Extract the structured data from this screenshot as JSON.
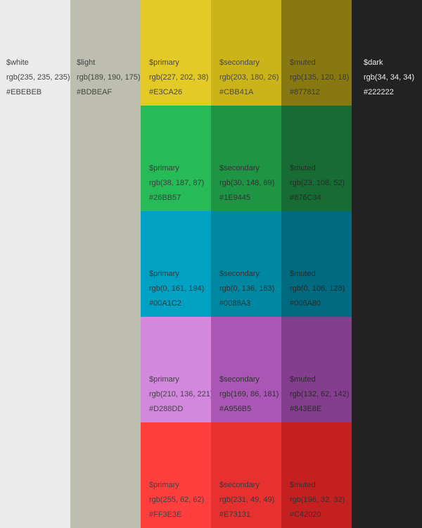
{
  "neutrals": {
    "white": {
      "name": "$white",
      "rgb": "rgb(235, 235, 235)",
      "hex": "#EBEBEB",
      "color": "#EBEBEB",
      "text_color": "#444444"
    },
    "light": {
      "name": "$light",
      "rgb": "rgb(189, 190, 175)",
      "hex": "#BDBEAF",
      "color": "#BDBEAF",
      "text_color": "#444444"
    },
    "dark": {
      "name": "$dark",
      "rgb": "rgb(34, 34, 34)",
      "hex": "#222222",
      "color": "#222222",
      "text_color": "#EEEEEE"
    }
  },
  "rows": [
    {
      "cells": [
        {
          "name": "$primary",
          "rgb": "rgb(227, 202, 38)",
          "hex": "#E3CA26",
          "color": "#E3CA26",
          "text_color": "#4A4A4A"
        },
        {
          "name": "$secondary",
          "rgb": "rgb(203, 180, 26)",
          "hex": "#CBB41A",
          "color": "#CBB41A",
          "text_color": "#4A4A4A"
        },
        {
          "name": "$muted",
          "rgb": "rgb(135, 120, 18)",
          "hex": "#877812",
          "color": "#877812",
          "text_color": "#3A3A3A"
        }
      ]
    },
    {
      "cells": [
        {
          "name": "$primary",
          "rgb": "rgb(38, 187, 87)",
          "hex": "#26BB57",
          "color": "#26BB57",
          "text_color": "#3E3E3E"
        },
        {
          "name": "$secondary",
          "rgb": "rgb(30, 148, 69)",
          "hex": "#1E9445",
          "color": "#1E9445",
          "text_color": "#333333"
        },
        {
          "name": "$muted",
          "rgb": "rgb(23, 108, 52)",
          "hex": "#876C34",
          "color": "#176C34",
          "text_color": "#2A2A2A"
        }
      ]
    },
    {
      "cells": [
        {
          "name": "$primary",
          "rgb": "rgb(0, 161, 194)",
          "hex": "#00A1C2",
          "color": "#00A1C2",
          "text_color": "#3A3A3A"
        },
        {
          "name": "$secondary",
          "rgb": "rgb(0, 136, 163)",
          "hex": "#0088A3",
          "color": "#0088A3",
          "text_color": "#333333"
        },
        {
          "name": "$muted",
          "rgb": "rgb(0, 106, 128)",
          "hex": "#006A80",
          "color": "#006A80",
          "text_color": "#2A2A2A"
        }
      ]
    },
    {
      "cells": [
        {
          "name": "$primary",
          "rgb": "rgb(210, 136, 221)",
          "hex": "#D288DD",
          "color": "#D288DD",
          "text_color": "#444444"
        },
        {
          "name": "$secondary",
          "rgb": "rgb(169, 86, 181)",
          "hex": "#A956B5",
          "color": "#A956B5",
          "text_color": "#333333"
        },
        {
          "name": "$muted",
          "rgb": "rgb(132, 62, 142)",
          "hex": "#843E8E",
          "color": "#843E8E",
          "text_color": "#2A2A2A"
        }
      ]
    },
    {
      "cells": [
        {
          "name": "$primary",
          "rgb": "rgb(255, 62, 62)",
          "hex": "#FF3E3E",
          "color": "#FF3E3E",
          "text_color": "#444444"
        },
        {
          "name": "$secondary",
          "rgb": "rgb(231, 49, 49)",
          "hex": "#E73131",
          "color": "#E73131",
          "text_color": "#3A3A3A"
        },
        {
          "name": "$muted",
          "rgb": "rgb(196, 32, 32)",
          "hex": "#C42020",
          "color": "#C42020",
          "text_color": "#333333"
        }
      ]
    }
  ]
}
